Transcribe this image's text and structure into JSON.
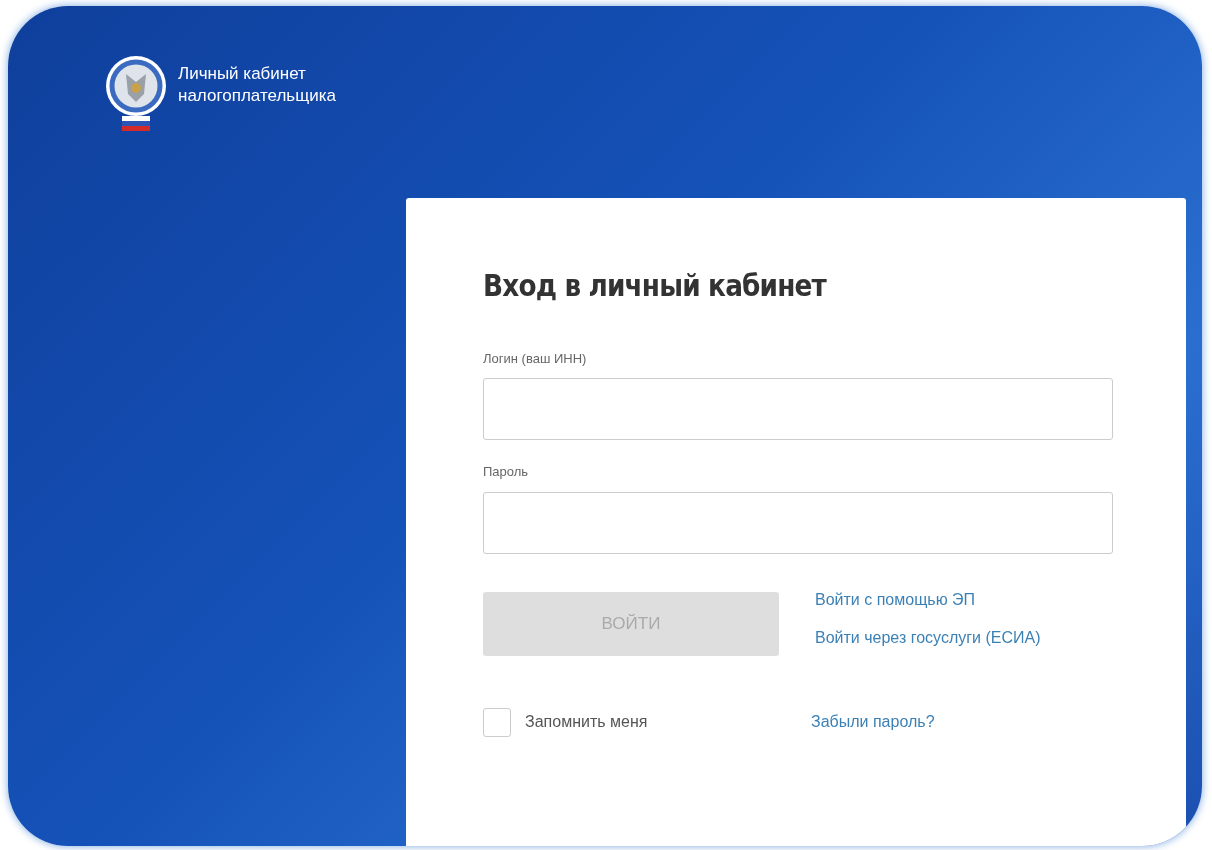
{
  "header": {
    "title_line1": "Личный кабинет",
    "title_line2": "налогоплательщика"
  },
  "login_form": {
    "heading": "Вход в личный кабинет",
    "fields": [
      {
        "label": "Логин (ваш ИНН)"
      },
      {
        "label": "Пароль"
      }
    ],
    "submit": {
      "label": "ВОЙТИ",
      "disabled": true
    },
    "links": [
      "Войти с помощью ЭП",
      "Войти через госуслуги (ЕСИА)"
    ],
    "remember": {
      "label": "Запомнить меня",
      "checked": false
    },
    "forgot_link": "Забыли пароль?"
  }
}
